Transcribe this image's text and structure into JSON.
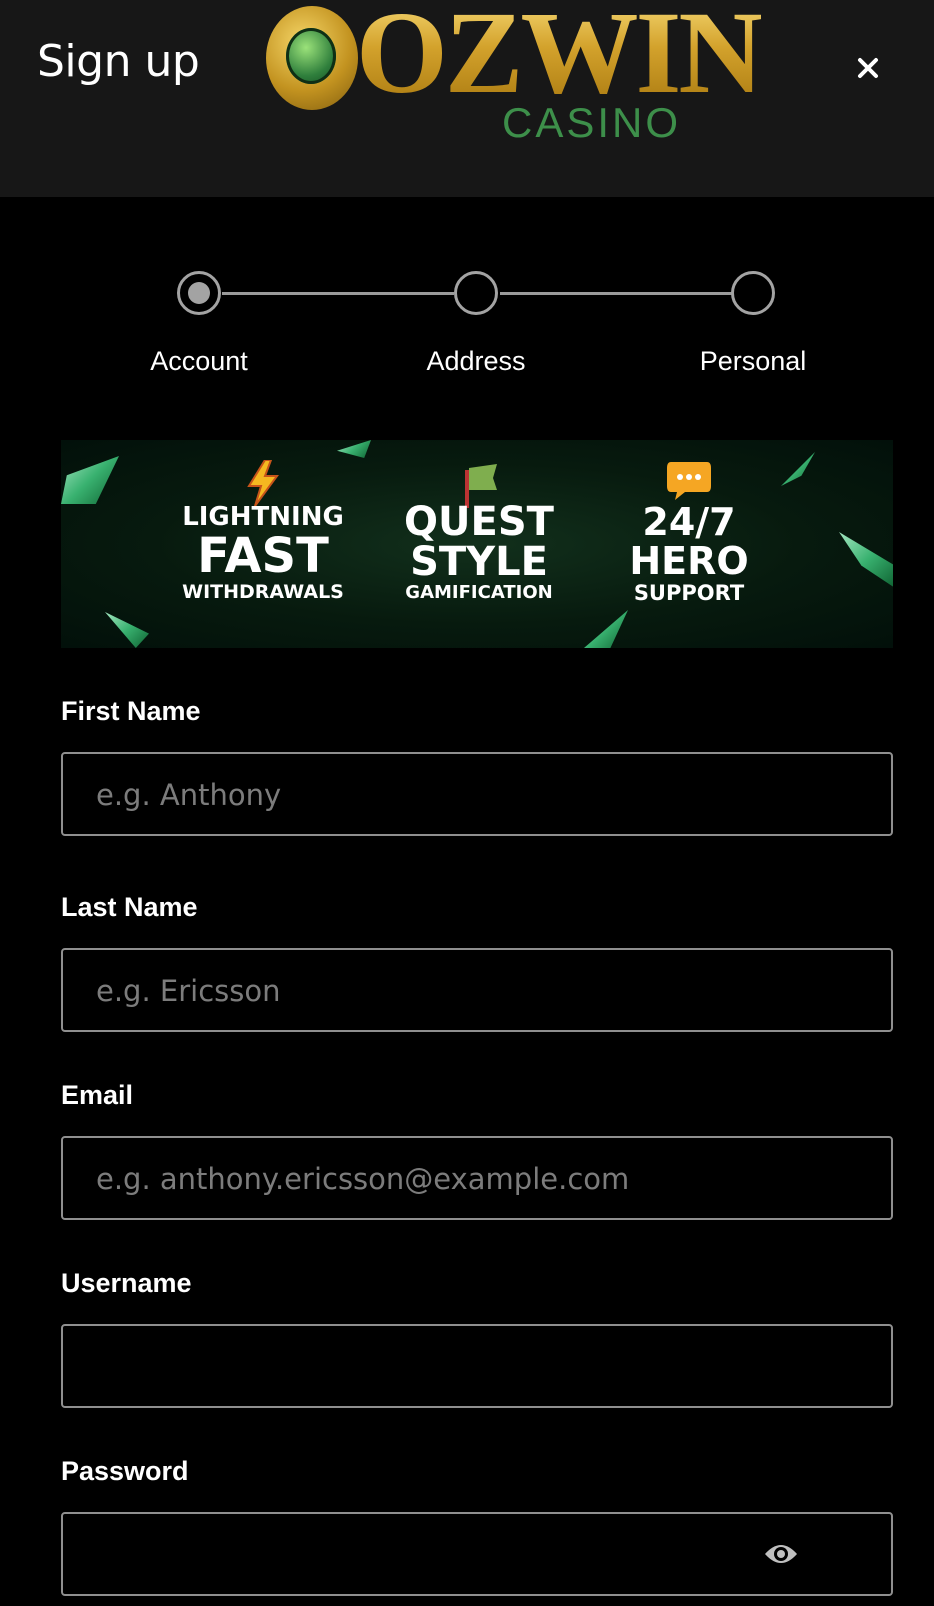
{
  "header": {
    "title": "Sign up",
    "logo_word": "OZWIN",
    "logo_sub": "CASINO"
  },
  "steps": [
    {
      "label": "Account",
      "active": true
    },
    {
      "label": "Address",
      "active": false
    },
    {
      "label": "Personal",
      "active": false
    }
  ],
  "banner": {
    "features": [
      {
        "icon": "lightning-icon",
        "line1": "LIGHTNING",
        "line2": "FAST",
        "line3": "WITHDRAWALS"
      },
      {
        "icon": "flag-icon",
        "line1": "QUEST",
        "line2": "STYLE",
        "line3": "GAMIFICATION"
      },
      {
        "icon": "chat-bubble-icon",
        "line1": "24/7",
        "line2": "HERO",
        "line3": "SUPPORT"
      }
    ]
  },
  "form": {
    "first_name": {
      "label": "First Name",
      "placeholder": "e.g. Anthony",
      "value": ""
    },
    "last_name": {
      "label": "Last Name",
      "placeholder": "e.g. Ericsson",
      "value": ""
    },
    "email": {
      "label": "Email",
      "placeholder": "e.g. anthony.ericsson@example.com",
      "value": ""
    },
    "username": {
      "label": "Username",
      "placeholder": "",
      "value": ""
    },
    "password": {
      "label": "Password",
      "placeholder": "",
      "value": "",
      "toggle_icon": "eye-icon"
    }
  },
  "colors": {
    "header_bg": "#171717",
    "page_bg": "#000000",
    "logo_gold": "#d9ad34",
    "logo_green": "#3d8f4a"
  }
}
